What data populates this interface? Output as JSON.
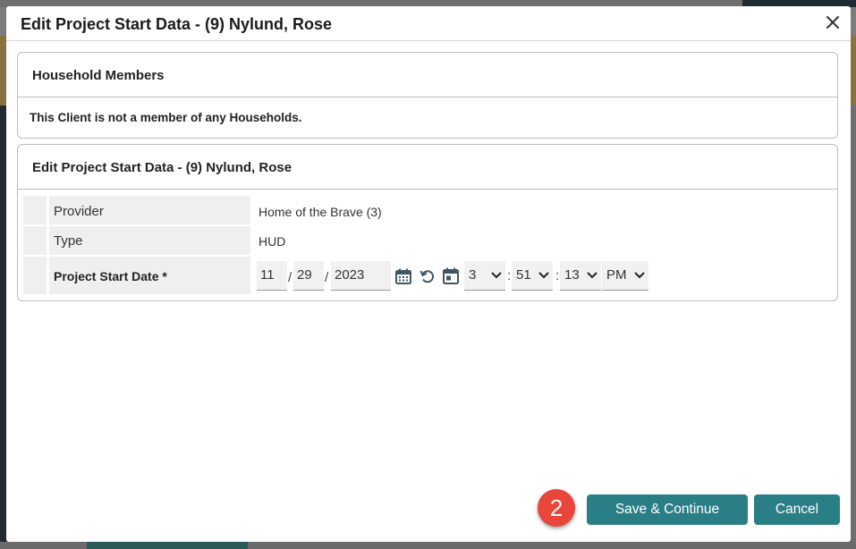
{
  "dialog": {
    "title": "Edit Project Start Data - (9) Nylund, Rose"
  },
  "household_panel": {
    "heading": "Household Members",
    "message": "This Client is not a member of any Households."
  },
  "edit_panel": {
    "heading": "Edit Project Start Data - (9) Nylund, Rose",
    "rows": {
      "provider": {
        "label": "Provider",
        "value": "Home of the Brave (3)"
      },
      "type": {
        "label": "Type",
        "value": "HUD"
      },
      "start_date": {
        "label": "Project Start Date *",
        "month": "11",
        "day": "29",
        "year": "2023",
        "date_sep": "/",
        "hour": "3",
        "minute": "51",
        "second": "13",
        "ampm": "PM",
        "time_sep": ":"
      }
    }
  },
  "footer": {
    "step_badge": "2",
    "save_label": "Save & Continue",
    "cancel_label": "Cancel"
  },
  "colors": {
    "accent": "#2a7f86",
    "badge": "#e8463a"
  },
  "icons": [
    "close-icon",
    "calendar-icon",
    "reset-icon",
    "calendar-today-icon",
    "chevron-down-icon"
  ]
}
